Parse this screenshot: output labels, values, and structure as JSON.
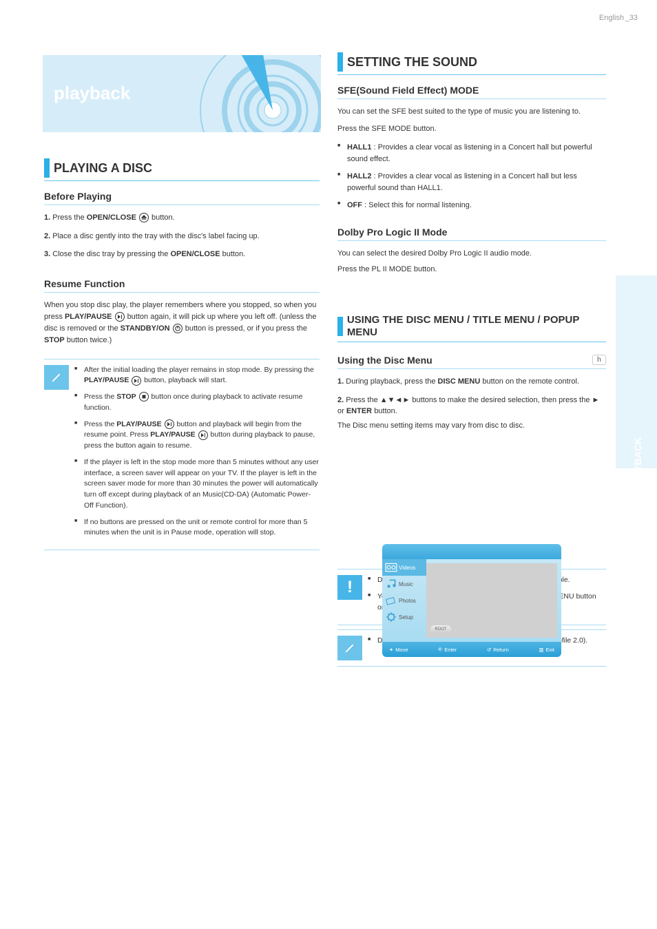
{
  "page_num_left": "English",
  "page_num_right": "_33",
  "side_tab": "PLAYBACK",
  "banner": {
    "title": "playback"
  },
  "left": {
    "section_title": "PLAYING A DISC",
    "sub1": {
      "title": "Before Playing",
      "p1a": "Press the ",
      "p1b": "OPEN/CLOSE",
      "p1c": " button.",
      "p1d": "Place a disc gently into the tray with the disc's label facing up.",
      "p1e": "Close the disc tray by pressing the ",
      "p1f": "OPEN/CLOSE",
      "p1g": " button."
    },
    "sub2": {
      "title": "Resume Function",
      "p1": "When you stop disc play, the player remembers where you stopped, so when you press ",
      "p1b": "PLAY/PAUSE",
      "p1c": " button again, it will pick up where you left off. (unless the disc is removed or the ",
      "p1d": "STANDBY/ON",
      "p1e": " button is pressed, or if you press the ",
      "p1f": "STOP",
      "p1g": " button twice.)"
    },
    "notes": {
      "n1a": "After the initial loading the player remains in stop mode. By pressing the ",
      "n1b": "PLAY/PAUSE",
      "n1c": " button, playback will start.",
      "n2a": "Press the ",
      "n2b": "STOP",
      "n2c": " button once during playback to activate resume function.",
      "n3a": "Press the ",
      "n3b": "PLAY/PAUSE",
      "n3c": " button and playback will begin from the resume point. Press ",
      "n3d": "PLAY/PAUSE",
      "n3e": " button during playback to pause, press the button again to resume.",
      "n4": "If the player is left in the stop mode more than 5 minutes without any user interface, a screen saver will appear on your TV. If the player is left in the screen saver mode for more than 30 minutes the power will automatically turn off except during playback of an Music(CD-DA) (Automatic Power-Off Function).",
      "n5": "If no buttons are pressed on the unit or remote control for more than 5 minutes when the unit is in Pause mode, operation will stop."
    }
  },
  "right": {
    "section_title": "SETTING THE SOUND",
    "sub1": {
      "title": "SFE(Sound Field Effect) MODE",
      "desc": "You can set the SFE best suited to the type of music you are listening to.",
      "step": "Press the SFE MODE button.",
      "opt1": {
        "label": "HALL1",
        "desc": " : Provides a clear vocal as listening in a Concert hall but powerful sound effect."
      },
      "opt2": {
        "label": "HALL2",
        "desc": " : Provides a clear vocal as listening in a Concert hall but less powerful sound than HALL1."
      },
      "opt3": {
        "label": "OFF",
        "desc": " : Select this for normal listening."
      }
    },
    "sub2": {
      "title": "Dolby Pro Logic II Mode",
      "desc": "You can select the desired Dolby Pro Logic II audio mode.",
      "step": "Press the       PL II MODE button."
    },
    "sub3": {
      "title": "USING THE DISC MENU / TITLE MENU / POPUP MENU"
    },
    "sub4": {
      "title": "Using the Disc Menu",
      "small": "h",
      "step1": {
        "a": "During playback, press the ",
        "b": "DISC MENU",
        "c": " button on the remote control."
      },
      "step2": {
        "a": "Press the ",
        "b": "▲▼◄►",
        "c": " buttons to make the desired selection, then press the ",
        "d": "►",
        "e": " or ",
        "f": "ENTER",
        "g": " button."
      },
      "note": "The Disc menu setting items may vary from disc to disc."
    },
    "screenshot": {
      "topbar": "",
      "sidebar": {
        "videos": "Videos",
        "music": "Music",
        "photos": "Photos",
        "setup": "Setup"
      },
      "root": "ROOT",
      "bottom": {
        "move": "Move",
        "enter": "Enter",
        "ret": "Return",
        "exit": "Exit"
      }
    },
    "alert": {
      "a1": "Depending on the disc, the Disc Menu may not be available.",
      "a2": "You can also use the Disc Menu by pressing the DISC MENU button on the remote control."
    },
    "note2": "Disc Menu button will go to the Title List for BD-ROM (Profile 2.0)."
  }
}
